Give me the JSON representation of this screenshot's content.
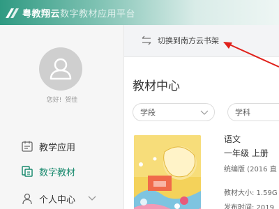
{
  "window": {
    "title_main": "粤教翔云",
    "title_sub": "数字教材应用平台"
  },
  "sidebar": {
    "greeting": [
      "您好!",
      "贺佳"
    ],
    "items": [
      {
        "label": "教学应用",
        "icon": "calendar-icon"
      },
      {
        "label": "数字教材",
        "icon": "book-icon",
        "active": true
      },
      {
        "label": "个人中心",
        "icon": "person-icon"
      }
    ]
  },
  "toolbar": {
    "switch_label": "切换到南方云书架"
  },
  "main": {
    "section_title": "教材中心",
    "filters": [
      {
        "placeholder": "学段"
      },
      {
        "placeholder": "学科"
      }
    ],
    "book": {
      "title": "语文",
      "grade": "一年级  上册",
      "edition": "统编版 (2016 直",
      "size": "教材大小: 1.59G",
      "date": "发布时间: 2019"
    }
  },
  "colors": {
    "accent": "#1a8a6e",
    "title_bar": "#2f9a82",
    "annotation_arrow": "#e0201a"
  }
}
